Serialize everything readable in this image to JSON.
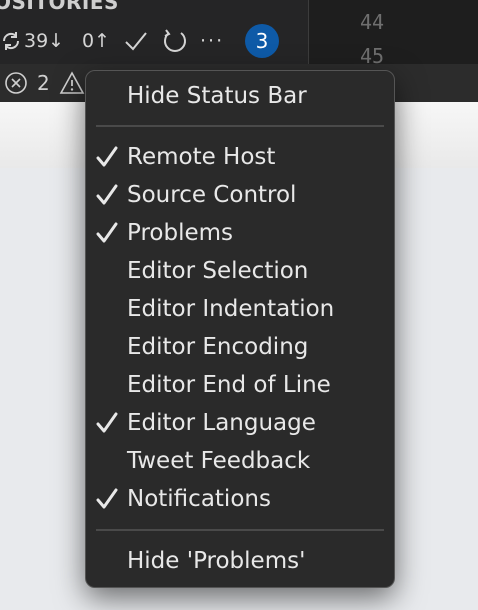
{
  "sidebar": {
    "header": "OSITORIES"
  },
  "sync": {
    "incoming": "39↓",
    "outgoing": "0↑",
    "badge": "3"
  },
  "editor": {
    "line_numbers": [
      "44",
      "45"
    ]
  },
  "status": {
    "errors": "2"
  },
  "menu": {
    "items": [
      {
        "label": "Hide Status Bar",
        "checked": false
      },
      {
        "label": "Remote Host",
        "checked": true
      },
      {
        "label": "Source Control",
        "checked": true
      },
      {
        "label": "Problems",
        "checked": true
      },
      {
        "label": "Editor Selection",
        "checked": false
      },
      {
        "label": "Editor Indentation",
        "checked": false
      },
      {
        "label": "Editor Encoding",
        "checked": false
      },
      {
        "label": "Editor End of Line",
        "checked": false
      },
      {
        "label": "Editor Language",
        "checked": true
      },
      {
        "label": "Tweet Feedback",
        "checked": false
      },
      {
        "label": "Notifications",
        "checked": true
      },
      {
        "label": "Hide 'Problems'",
        "checked": false
      }
    ]
  },
  "colors": {
    "badge": "#0e5aa7",
    "menu_bg": "#2a2a2a"
  }
}
